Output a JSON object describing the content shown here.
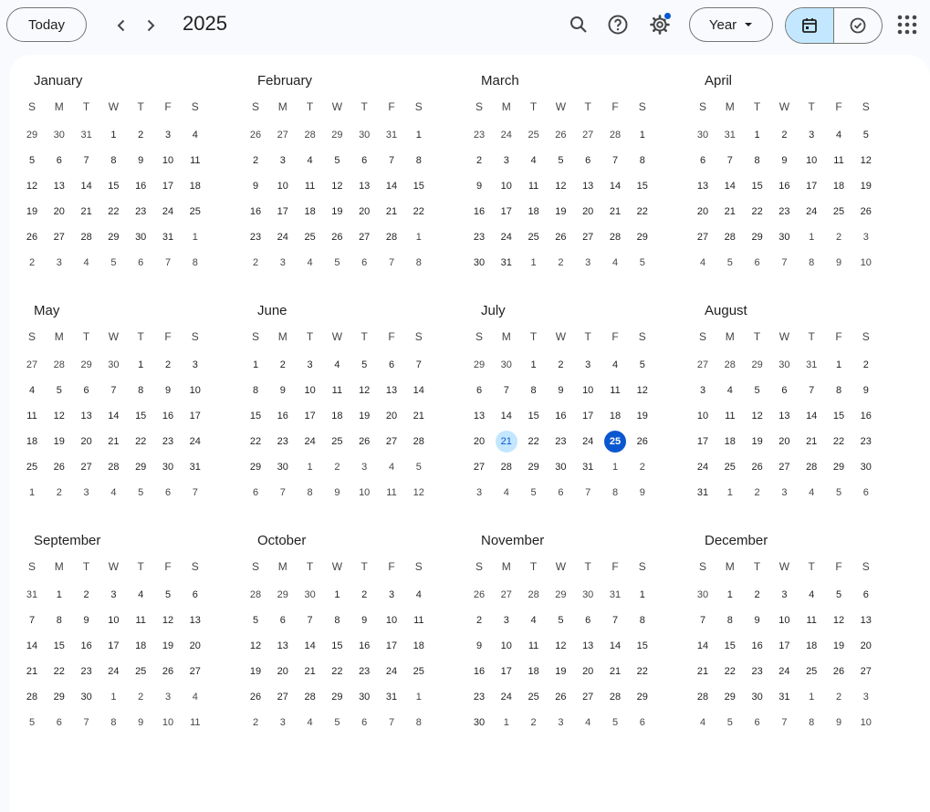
{
  "header": {
    "today_label": "Today",
    "year": "2025",
    "view_label": "Year",
    "icons": [
      "chevron-left-icon",
      "chevron-right-icon",
      "search-icon",
      "help-icon",
      "settings-icon",
      "calendar-icon",
      "tasks-check-icon",
      "apps-grid-icon"
    ],
    "accent_color": "#0b57d0",
    "selected_color": "#c2e7ff"
  },
  "weekdays": [
    "S",
    "M",
    "T",
    "W",
    "T",
    "F",
    "S"
  ],
  "months": [
    {
      "name": "January",
      "lead": [
        29,
        30,
        31
      ],
      "days": 31,
      "trail": [
        1,
        2,
        3,
        4,
        5,
        6,
        7,
        8
      ]
    },
    {
      "name": "February",
      "lead": [
        26,
        27,
        28,
        29,
        30,
        31
      ],
      "days": 28,
      "trail": [
        1,
        2,
        3,
        4,
        5,
        6,
        7,
        8
      ]
    },
    {
      "name": "March",
      "lead": [
        23,
        24,
        25,
        26,
        27,
        28
      ],
      "days": 31,
      "trail": [
        1,
        2,
        3,
        4,
        5
      ]
    },
    {
      "name": "April",
      "lead": [
        30,
        31
      ],
      "days": 30,
      "trail": [
        1,
        2,
        3,
        4,
        5,
        6,
        7,
        8,
        9,
        10
      ]
    },
    {
      "name": "May",
      "lead": [
        27,
        28,
        29,
        30
      ],
      "days": 31,
      "trail": [
        1,
        2,
        3,
        4,
        5,
        6,
        7
      ]
    },
    {
      "name": "June",
      "lead": [],
      "days": 30,
      "trail": [
        1,
        2,
        3,
        4,
        5,
        6,
        7,
        8,
        9,
        10,
        11,
        12
      ]
    },
    {
      "name": "July",
      "lead": [
        29,
        30
      ],
      "days": 31,
      "trail": [
        1,
        2,
        3,
        4,
        5,
        6,
        7,
        8,
        9
      ],
      "selected": 21,
      "today": 25
    },
    {
      "name": "August",
      "lead": [
        27,
        28,
        29,
        30,
        31
      ],
      "days": 31,
      "trail": [
        1,
        2,
        3,
        4,
        5,
        6
      ]
    },
    {
      "name": "September",
      "lead": [
        31
      ],
      "days": 30,
      "trail": [
        1,
        2,
        3,
        4,
        5,
        6,
        7,
        8,
        9,
        10,
        11
      ]
    },
    {
      "name": "October",
      "lead": [
        28,
        29,
        30
      ],
      "days": 31,
      "trail": [
        1,
        2,
        3,
        4,
        5,
        6,
        7,
        8
      ]
    },
    {
      "name": "November",
      "lead": [
        26,
        27,
        28,
        29,
        30,
        31
      ],
      "days": 30,
      "trail": [
        1,
        2,
        3,
        4,
        5,
        6
      ]
    },
    {
      "name": "December",
      "lead": [
        30
      ],
      "days": 31,
      "trail": [
        1,
        2,
        3,
        4,
        5,
        6,
        7,
        8,
        9,
        10
      ]
    }
  ]
}
